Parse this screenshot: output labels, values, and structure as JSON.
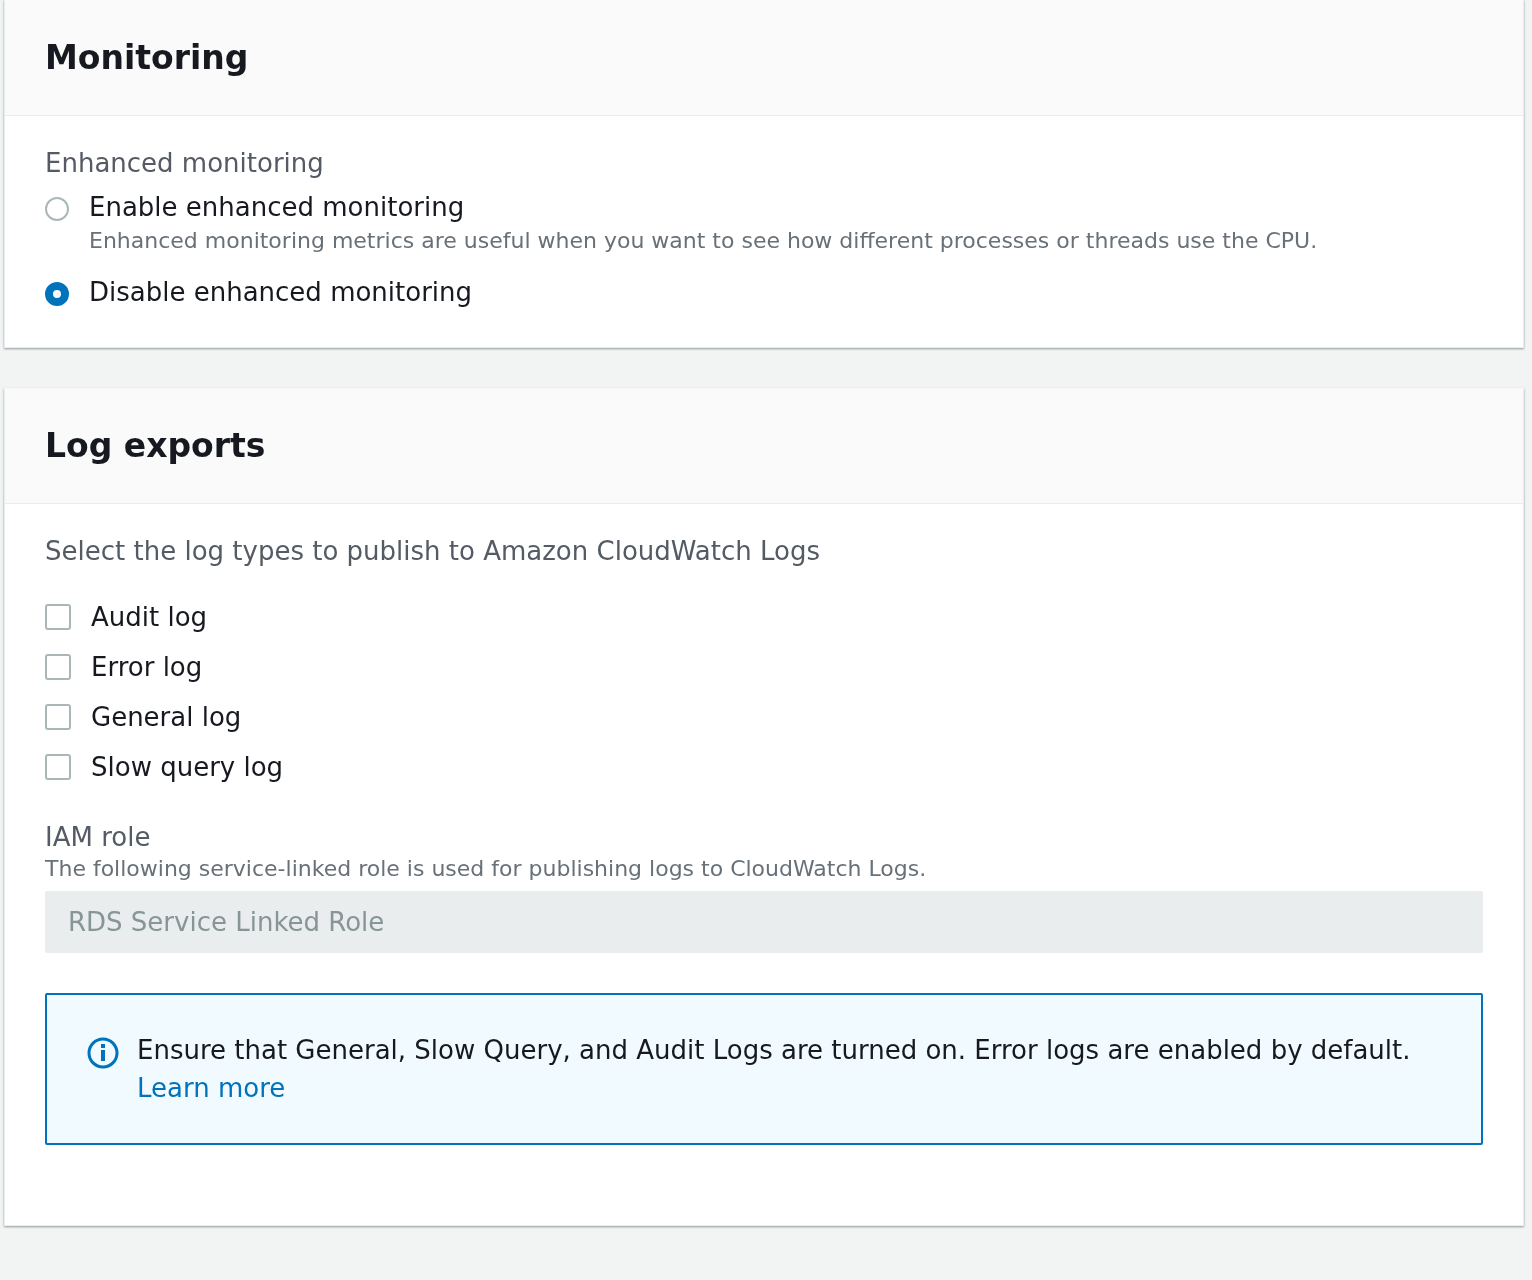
{
  "monitoring": {
    "title": "Monitoring",
    "field_label": "Enhanced monitoring",
    "options": [
      {
        "label": "Enable enhanced monitoring",
        "description": "Enhanced monitoring metrics are useful when you want to see how different processes or threads use the CPU.",
        "selected": false
      },
      {
        "label": "Disable enhanced monitoring",
        "selected": true
      }
    ]
  },
  "log_exports": {
    "title": "Log exports",
    "intro": "Select the log types to publish to Amazon CloudWatch Logs",
    "log_types": [
      {
        "label": "Audit log",
        "checked": false
      },
      {
        "label": "Error log",
        "checked": false
      },
      {
        "label": "General log",
        "checked": false
      },
      {
        "label": "Slow query log",
        "checked": false
      }
    ],
    "iam_role": {
      "label": "IAM role",
      "description": "The following service-linked role is used for publishing logs to CloudWatch Logs.",
      "value": "RDS Service Linked Role",
      "disabled": true
    },
    "info": {
      "text": "Ensure that General, Slow Query, and Audit Logs are turned on. Error logs are enabled by default.",
      "link": "Learn more"
    }
  }
}
